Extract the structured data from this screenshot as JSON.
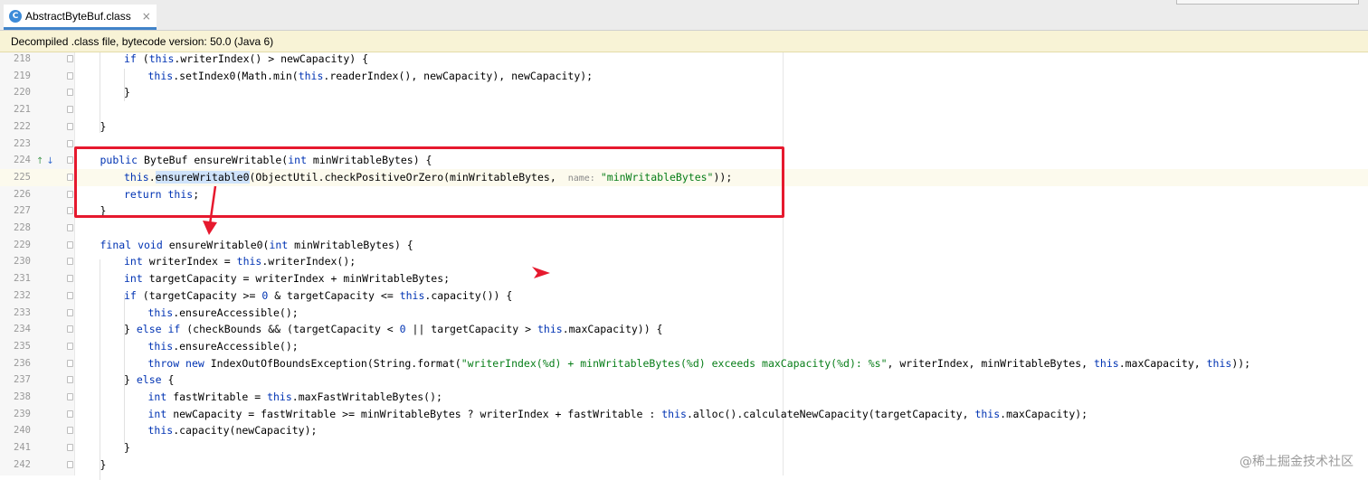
{
  "tab": {
    "label": "AbstractByteBuf.class",
    "icon": "class-file-icon",
    "icon_glyph": "C",
    "close": "×"
  },
  "banner": {
    "text": "Decompiled .class file, bytecode version: 50.0 (Java 6)"
  },
  "gutter_icons": [
    "↑",
    "↓"
  ],
  "colors": {
    "accent": "#4083c9",
    "annotation_red": "#e6192e",
    "keyword": "#0033b3",
    "string": "#067d17"
  },
  "lines": [
    {
      "n": "218",
      "indent": 2,
      "tokens": [
        [
          "kw",
          "if"
        ],
        [
          "t",
          " ("
        ],
        [
          "kw",
          "this"
        ],
        [
          "t",
          ".writerIndex() > newCapacity) {"
        ]
      ]
    },
    {
      "n": "219",
      "indent": 3,
      "tokens": [
        [
          "kw",
          "this"
        ],
        [
          "t",
          ".setIndex0(Math.min("
        ],
        [
          "kw",
          "this"
        ],
        [
          "t",
          ".readerIndex(), newCapacity), newCapacity);"
        ]
      ]
    },
    {
      "n": "220",
      "indent": 2,
      "tokens": [
        [
          "t",
          "}"
        ]
      ]
    },
    {
      "n": "221",
      "indent": 0,
      "tokens": []
    },
    {
      "n": "222",
      "indent": 1,
      "tokens": [
        [
          "t",
          "}"
        ]
      ]
    },
    {
      "n": "223",
      "indent": 0,
      "tokens": []
    },
    {
      "n": "224",
      "indent": 1,
      "tokens": [
        [
          "kw",
          "public"
        ],
        [
          "t",
          " ByteBuf ensureWritable("
        ],
        [
          "kw",
          "int"
        ],
        [
          "t",
          " minWritableBytes) {"
        ]
      ]
    },
    {
      "n": "225",
      "indent": 2,
      "current": true,
      "tokens": [
        [
          "kw",
          "this"
        ],
        [
          "t",
          "."
        ],
        [
          "hl",
          "ensureWritable0"
        ],
        [
          "t",
          "(ObjectUtil.checkPositiveOrZero(minWritableBytes, "
        ],
        [
          "hint",
          " name: "
        ],
        [
          "str",
          "\"minWritableBytes\""
        ],
        [
          "t",
          "));"
        ]
      ]
    },
    {
      "n": "226",
      "indent": 2,
      "tokens": [
        [
          "kw",
          "return"
        ],
        [
          "t",
          " "
        ],
        [
          "kw",
          "this"
        ],
        [
          "t",
          ";"
        ]
      ]
    },
    {
      "n": "227",
      "indent": 1,
      "tokens": [
        [
          "t",
          "}"
        ]
      ]
    },
    {
      "n": "228",
      "indent": 0,
      "tokens": []
    },
    {
      "n": "229",
      "indent": 1,
      "tokens": [
        [
          "kw",
          "final"
        ],
        [
          "t",
          " "
        ],
        [
          "kw",
          "void"
        ],
        [
          "t",
          " ensureWritable0("
        ],
        [
          "kw",
          "int"
        ],
        [
          "t",
          " minWritableBytes) {"
        ]
      ]
    },
    {
      "n": "230",
      "indent": 2,
      "tokens": [
        [
          "kw",
          "int"
        ],
        [
          "t",
          " writerIndex = "
        ],
        [
          "kw",
          "this"
        ],
        [
          "t",
          ".writerIndex();"
        ]
      ]
    },
    {
      "n": "231",
      "indent": 2,
      "tokens": [
        [
          "kw",
          "int"
        ],
        [
          "t",
          " targetCapacity = writerIndex + minWritableBytes;"
        ]
      ]
    },
    {
      "n": "232",
      "indent": 2,
      "tokens": [
        [
          "kw",
          "if"
        ],
        [
          "t",
          " (targetCapacity >= "
        ],
        [
          "kw",
          "0"
        ],
        [
          "t",
          " & targetCapacity <= "
        ],
        [
          "kw",
          "this"
        ],
        [
          "t",
          ".capacity()) {"
        ]
      ]
    },
    {
      "n": "233",
      "indent": 3,
      "tokens": [
        [
          "kw",
          "this"
        ],
        [
          "t",
          ".ensureAccessible();"
        ]
      ]
    },
    {
      "n": "234",
      "indent": 2,
      "tokens": [
        [
          "t",
          "} "
        ],
        [
          "kw",
          "else if"
        ],
        [
          "t",
          " (checkBounds && (targetCapacity < "
        ],
        [
          "kw",
          "0"
        ],
        [
          "t",
          " || targetCapacity > "
        ],
        [
          "kw",
          "this"
        ],
        [
          "t",
          ".maxCapacity)) {"
        ]
      ]
    },
    {
      "n": "235",
      "indent": 3,
      "tokens": [
        [
          "kw",
          "this"
        ],
        [
          "t",
          ".ensureAccessible();"
        ]
      ]
    },
    {
      "n": "236",
      "indent": 3,
      "tokens": [
        [
          "kw",
          "throw new"
        ],
        [
          "t",
          " IndexOutOfBoundsException(String.format("
        ],
        [
          "str",
          "\"writerIndex(%d) + minWritableBytes(%d) exceeds maxCapacity(%d): %s\""
        ],
        [
          "t",
          ", writerIndex, minWritableBytes, "
        ],
        [
          "kw",
          "this"
        ],
        [
          "t",
          ".maxCapacity, "
        ],
        [
          "kw",
          "this"
        ],
        [
          "t",
          "));"
        ]
      ]
    },
    {
      "n": "237",
      "indent": 2,
      "tokens": [
        [
          "t",
          "} "
        ],
        [
          "kw",
          "else"
        ],
        [
          "t",
          " {"
        ]
      ]
    },
    {
      "n": "238",
      "indent": 3,
      "tokens": [
        [
          "kw",
          "int"
        ],
        [
          "t",
          " fastWritable = "
        ],
        [
          "kw",
          "this"
        ],
        [
          "t",
          ".maxFastWritableBytes();"
        ]
      ]
    },
    {
      "n": "239",
      "indent": 3,
      "tokens": [
        [
          "kw",
          "int"
        ],
        [
          "t",
          " newCapacity = fastWritable >= minWritableBytes ? writerIndex + fastWritable : "
        ],
        [
          "kw",
          "this"
        ],
        [
          "t",
          ".alloc().calculateNewCapacity(targetCapacity, "
        ],
        [
          "kw",
          "this"
        ],
        [
          "t",
          ".maxCapacity);"
        ]
      ]
    },
    {
      "n": "240",
      "indent": 3,
      "tokens": [
        [
          "kw",
          "this"
        ],
        [
          "t",
          ".capacity(newCapacity);"
        ]
      ]
    },
    {
      "n": "241",
      "indent": 2,
      "tokens": [
        [
          "t",
          "}"
        ]
      ]
    },
    {
      "n": "242",
      "indent": 1,
      "tokens": [
        [
          "t",
          "}"
        ]
      ]
    }
  ],
  "watermark": "@稀土掘金技术社区"
}
